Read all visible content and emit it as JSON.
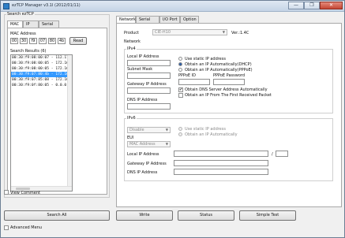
{
  "window": {
    "title": "ezTCP Manager v3.1I (2012/01/11)",
    "minimize": "—",
    "maximize": "❐",
    "close": "✕"
  },
  "search": {
    "group_title": "Search ezTCP",
    "tabs": [
      "MAC",
      "IP",
      "Serial"
    ],
    "mac_label": "MAC Address",
    "mac_octets": [
      "00",
      "30",
      "f9",
      "07",
      "80",
      "4b"
    ],
    "read_button": "Read",
    "results_label": "Search Results (6)",
    "results": [
      "00:30:f9:08:00:07 - 112.171...",
      "00:30:f9:08:00:05 - 172.16.(",
      "00:30:f9:08:00:05 - 172.16.(",
      "00:30:f9:07:80:4b - 172.16.(",
      "00:30:f9:07:85:08 - 172.16.(",
      "00:30:f9:0f:80:05 - 0.0.0.0"
    ],
    "selected_index": 3,
    "view_comment": "View Comment",
    "search_all": "Search All"
  },
  "config": {
    "tabs": [
      "Network",
      "Serial Port",
      "I/O Port",
      "Option"
    ],
    "product_label": "Product",
    "product_value": "CIE-H10",
    "version": "Ver.:1.4C",
    "network_label": "Network",
    "ipv4": {
      "title": "IPv4",
      "local_ip": "Local IP Address",
      "subnet": "Subnet Mask",
      "gateway": "Gateway IP Address",
      "dns": "DNS IP Address",
      "use_static": "Use static IP address",
      "dhcp": "Obtain an IP Automatically(DHCP)",
      "pppoe": "Obtain an IP Automatically(PPPoE)",
      "pppoe_id": "PPPoE ID",
      "pppoe_pw": "PPPoE Password",
      "dns_auto": "Obtain DNS Server Address Automatically",
      "first_packet": "Obtain an IP From The First Received Packet"
    },
    "ipv6": {
      "title": "IPv6",
      "mode_value": "Disable",
      "eui_label": "EUI",
      "eui_value": "MAC Address",
      "use_static": "Use static IP address",
      "auto": "Obtain an IP Automatically",
      "local_ip": "Local IP Address",
      "gateway": "Gateway IP Address",
      "dns": "DNS IP Address",
      "slash": "/"
    }
  },
  "buttons": {
    "write": "Write",
    "status": "Status",
    "simple_test": "Simple Test"
  },
  "advanced_menu": "Advanced Menu"
}
